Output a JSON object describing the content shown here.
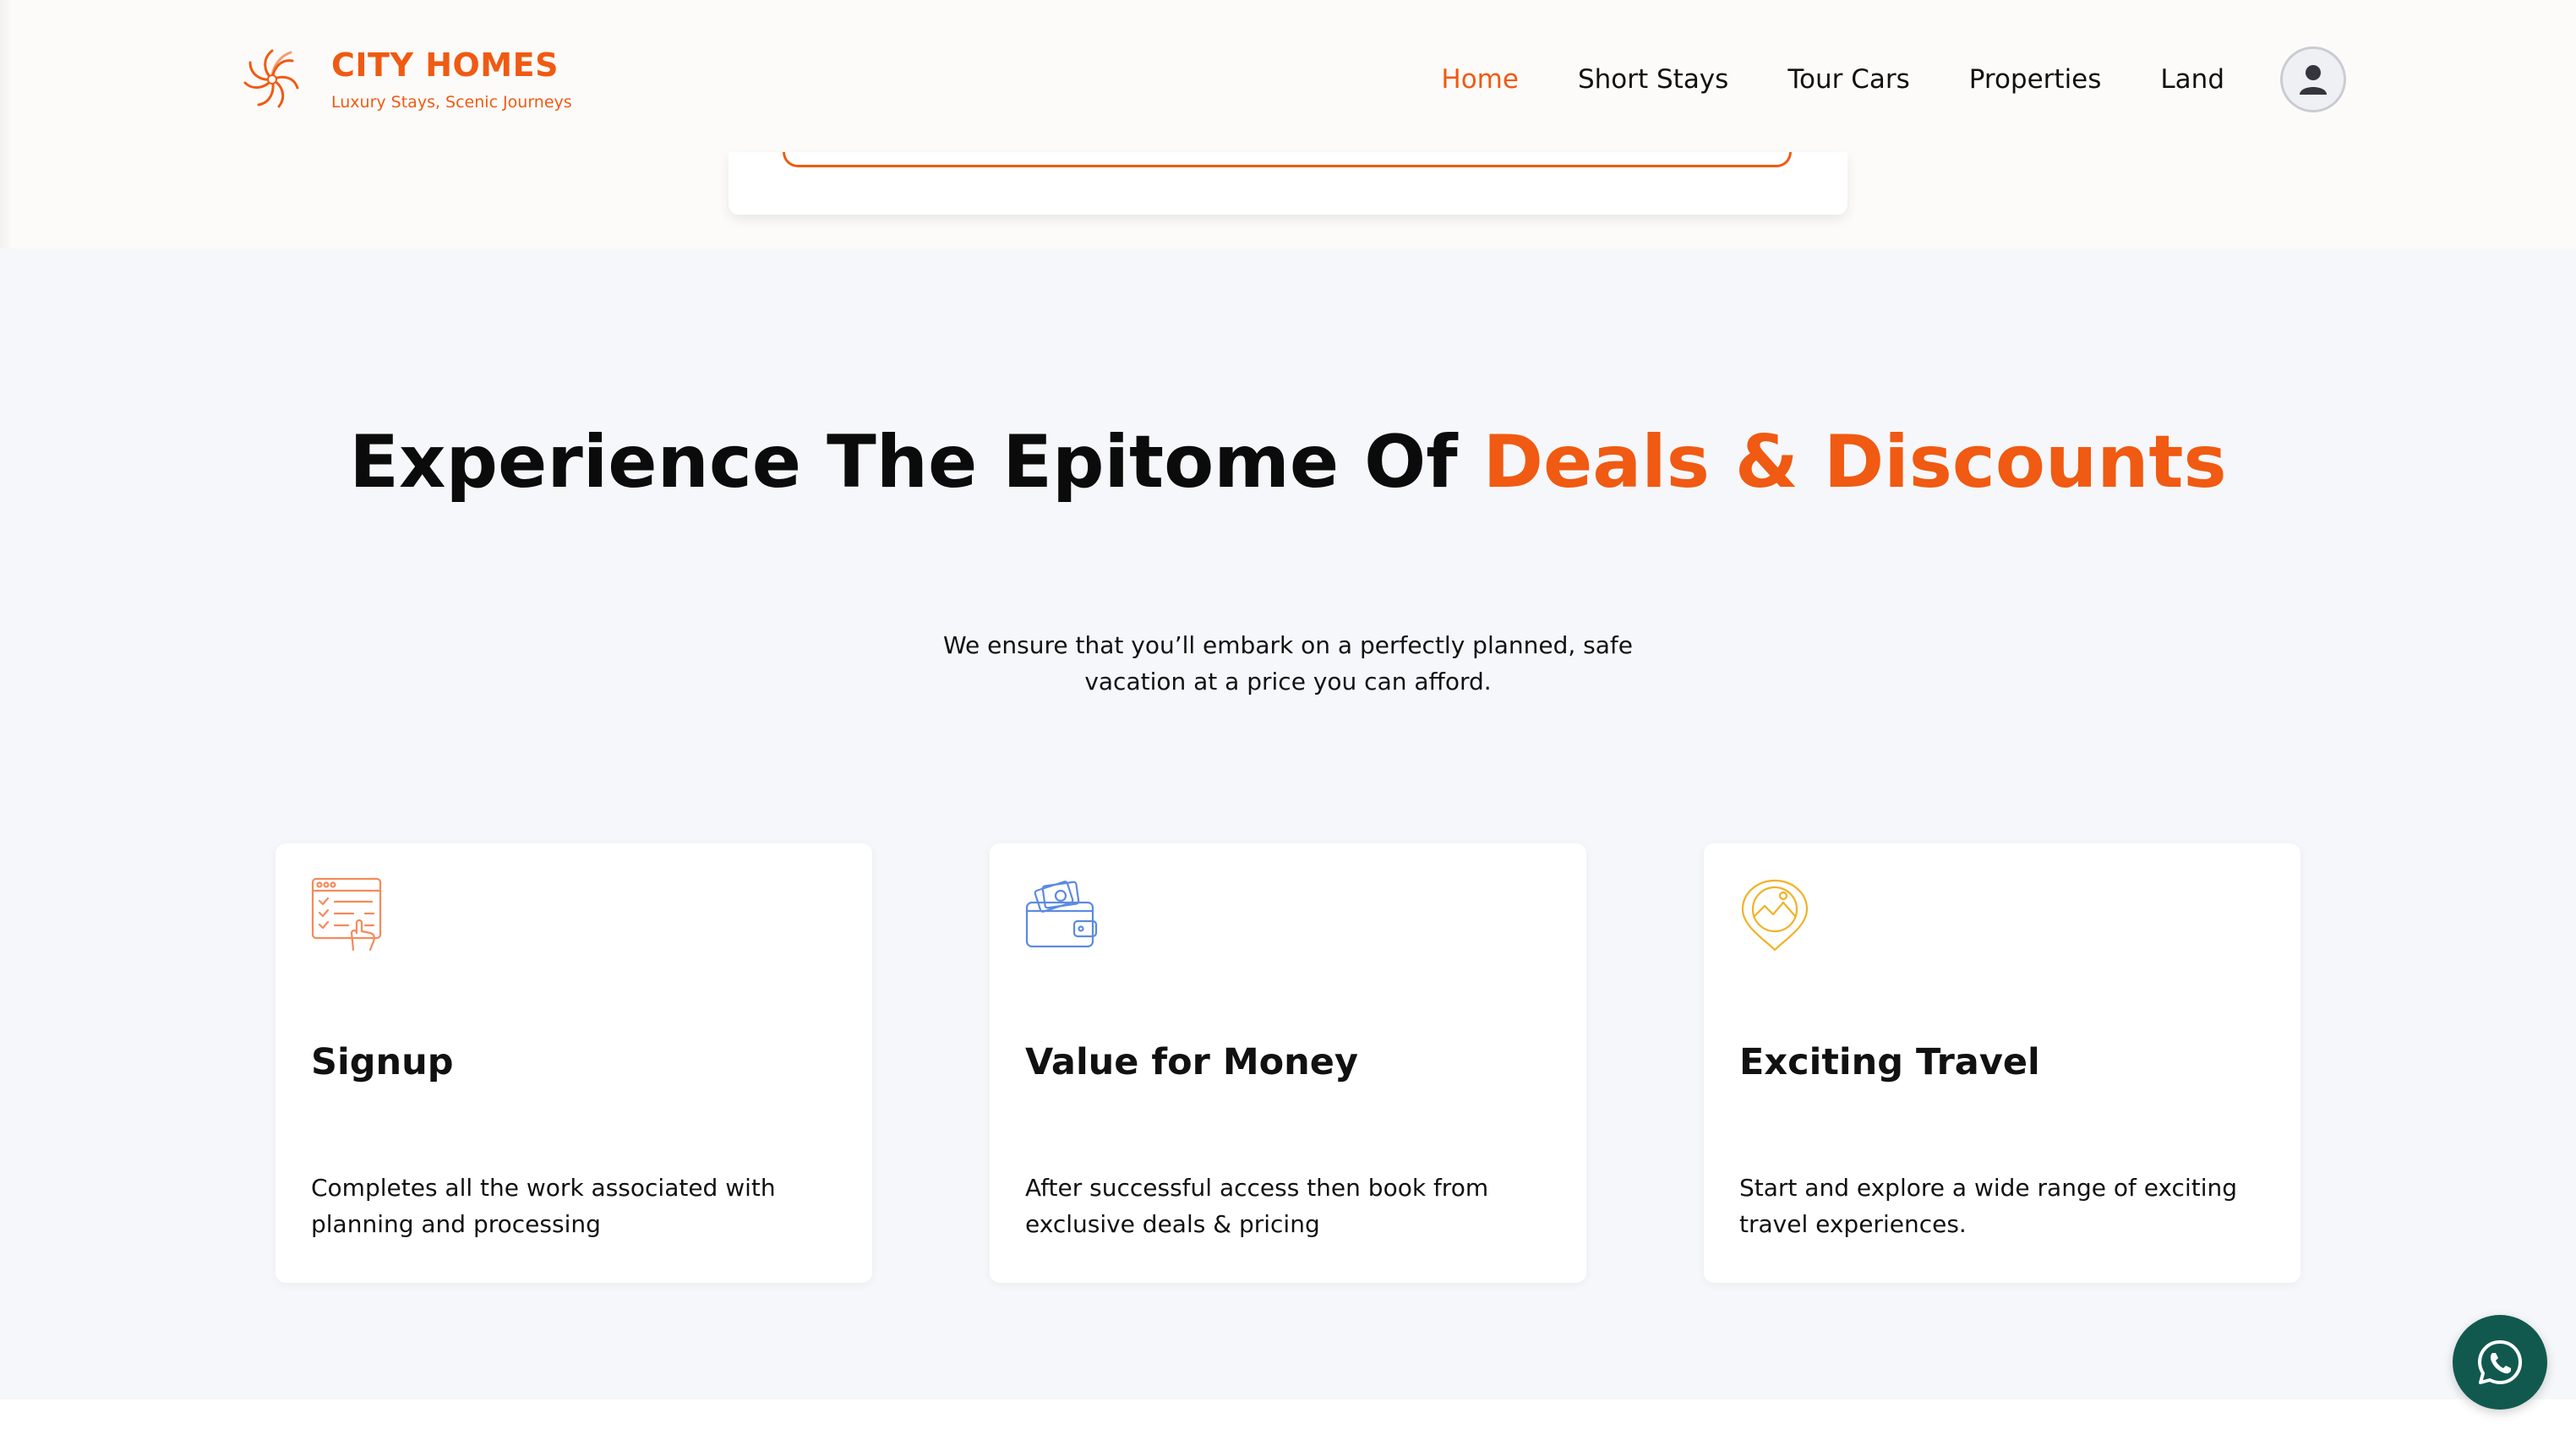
{
  "brand": {
    "name": "CITY HOMES",
    "tagline": "Luxury Stays, Scenic Journeys",
    "color": "#f05a12"
  },
  "nav": {
    "items": [
      {
        "label": "Home",
        "active": true
      },
      {
        "label": "Short Stays",
        "active": false
      },
      {
        "label": "Tour Cars",
        "active": false
      },
      {
        "label": "Properties",
        "active": false
      },
      {
        "label": "Land",
        "active": false
      }
    ],
    "profile_icon": "user-icon"
  },
  "section": {
    "heading_plain": "Experience The Epitome Of ",
    "heading_accent": "Deals & Discounts",
    "subtext": "We ensure that you’ll embark on a perfectly planned, safe vacation at a price you can afford."
  },
  "features": [
    {
      "title": "Signup",
      "description": "Completes all the work associated with planning and processing",
      "icon": "signup-form-icon",
      "icon_color": "#f58a5c"
    },
    {
      "title": "Value for Money",
      "description": "After successful access then book from exclusive deals & pricing",
      "icon": "wallet-icon",
      "icon_color": "#5b8be0"
    },
    {
      "title": "Exciting Travel",
      "description": "Start and explore a wide range of exciting travel experiences.",
      "icon": "location-pin-icon",
      "icon_color": "#f2b227"
    }
  ],
  "whatsapp": {
    "icon": "whatsapp-icon",
    "color": "#11594f"
  }
}
